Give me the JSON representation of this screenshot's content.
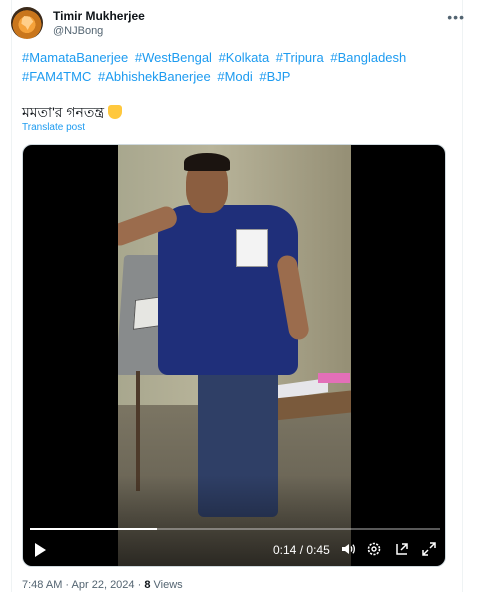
{
  "author": {
    "name": "Timir Mukherjee",
    "handle": "@NJBong"
  },
  "post": {
    "hashtags": [
      "#MamataBanerjee",
      "#WestBengal",
      "#Kolkata",
      "#Tripura",
      "#Bangladesh",
      "#FAM4TMC",
      "#AbhishekBanerjee",
      "#Modi",
      "#BJP"
    ],
    "text": "মমতা'র গনতন্ত্র",
    "emoji_icon": "pointing-down-hand-icon",
    "translate_label": "Translate post"
  },
  "video": {
    "current_time": "0:14",
    "separator": "/",
    "duration": "0:45",
    "progress": 0.31,
    "icons": [
      "play-icon",
      "volume-icon",
      "settings-icon",
      "pip-icon",
      "fullscreen-icon"
    ]
  },
  "footer": {
    "time": "7:48 AM",
    "dot": "·",
    "date": "Apr 22, 2024",
    "views_count": "8",
    "views_label": "Views"
  },
  "colors": {
    "link": "#1d9bf0",
    "secondary_text": "#536471"
  }
}
